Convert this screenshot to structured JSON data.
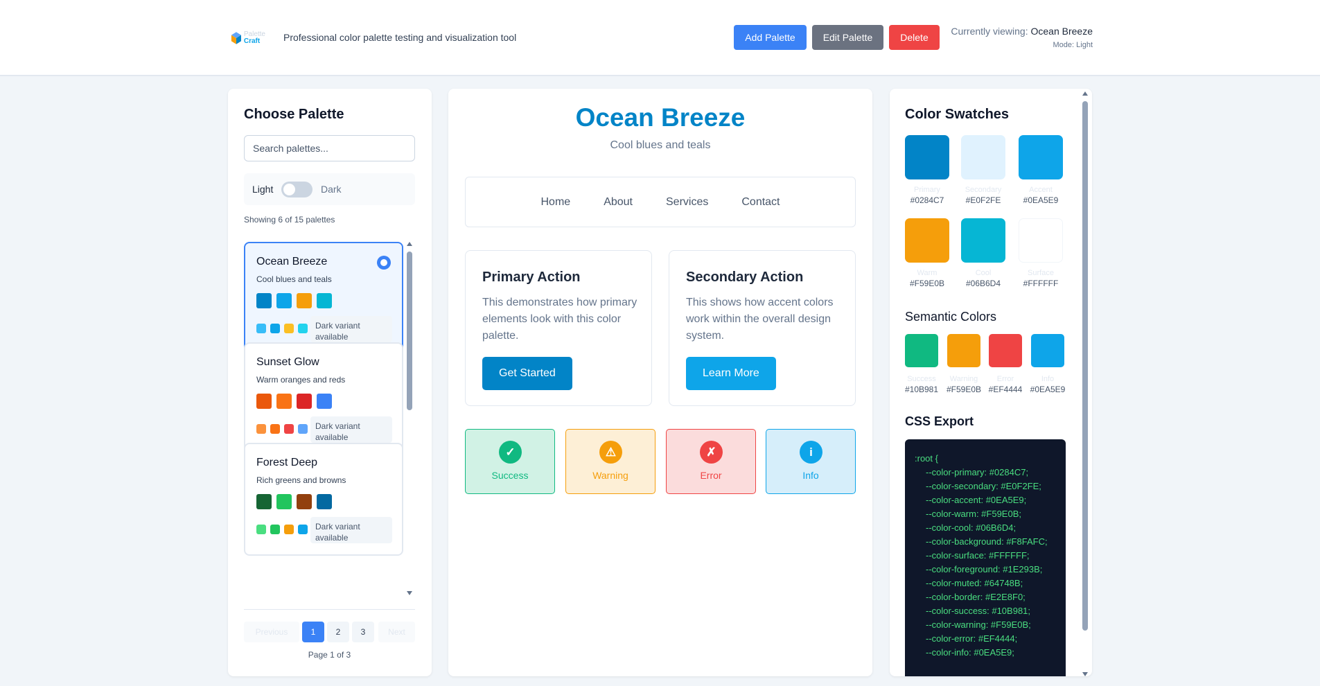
{
  "header": {
    "logo_top": "Palette",
    "logo_bottom": "Craft",
    "tagline": "Professional color palette testing and visualization tool",
    "add_label": "Add Palette",
    "edit_label": "Edit Palette",
    "delete_label": "Delete",
    "viewing_label": "Currently viewing:",
    "viewing_name": "Ocean Breeze",
    "mode_text": "Mode: Light"
  },
  "sidebar": {
    "title": "Choose Palette",
    "search_placeholder": "Search palettes...",
    "toggle_light": "Light",
    "toggle_dark": "Dark",
    "showing": "Showing 6 of 15 palettes",
    "palettes": [
      {
        "name": "Ocean Breeze",
        "description": "Cool blues and teals",
        "colors": [
          "#0284C7",
          "#0EA5E9",
          "#F59E0B",
          "#06B6D4"
        ],
        "dark_colors": [
          "#38BDF8",
          "#0EA5E9",
          "#FBBF24",
          "#22D3EE"
        ],
        "dark_label": "Dark variant available",
        "selected": true
      },
      {
        "name": "Sunset Glow",
        "description": "Warm oranges and reds",
        "colors": [
          "#EA580C",
          "#F97316",
          "#DC2626",
          "#3B82F6"
        ],
        "dark_colors": [
          "#FB923C",
          "#F97316",
          "#EF4444",
          "#60A5FA"
        ],
        "dark_label": "Dark variant available",
        "selected": false
      },
      {
        "name": "Forest Deep",
        "description": "Rich greens and browns",
        "colors": [
          "#166534",
          "#22C55E",
          "#92400E",
          "#0369A1"
        ],
        "dark_colors": [
          "#4ADE80",
          "#22C55E",
          "#F59E0B",
          "#0EA5E9"
        ],
        "dark_label": "Dark variant available",
        "selected": false
      }
    ],
    "pagination": {
      "prev": "Previous",
      "pages": [
        "1",
        "2",
        "3"
      ],
      "next": "Next",
      "info": "Page 1 of 3"
    }
  },
  "preview": {
    "title": "Ocean Breeze",
    "subtitle": "Cool blues and teals",
    "nav": [
      "Home",
      "About",
      "Services",
      "Contact"
    ],
    "cards": [
      {
        "title": "Primary Action",
        "text": "This demonstrates how primary elements look with this color palette.",
        "button": "Get Started"
      },
      {
        "title": "Secondary Action",
        "text": "This shows how accent colors work within the overall design system.",
        "button": "Learn More"
      }
    ],
    "statuses": [
      {
        "label": "Success",
        "icon": "✓"
      },
      {
        "label": "Warning",
        "icon": "⚠"
      },
      {
        "label": "Error",
        "icon": "✗"
      },
      {
        "label": "Info",
        "icon": "i"
      }
    ]
  },
  "swatches": {
    "title": "Color Swatches",
    "items": [
      {
        "name": "Primary",
        "hex": "#0284C7"
      },
      {
        "name": "Secondary",
        "hex": "#E0F2FE"
      },
      {
        "name": "Accent",
        "hex": "#0EA5E9"
      },
      {
        "name": "Warm",
        "hex": "#F59E0B"
      },
      {
        "name": "Cool",
        "hex": "#06B6D4"
      },
      {
        "name": "Surface",
        "hex": "#FFFFFF"
      }
    ],
    "semantic_title": "Semantic Colors",
    "semantic": [
      {
        "name": "Success",
        "hex": "#10B981"
      },
      {
        "name": "Warning",
        "hex": "#F59E0B"
      },
      {
        "name": "Error",
        "hex": "#EF4444"
      },
      {
        "name": "Info",
        "hex": "#0EA5E9"
      }
    ],
    "css_title": "CSS Export",
    "css_open": ":root {",
    "css_lines": [
      "--color-primary: #0284C7;",
      "--color-secondary: #E0F2FE;",
      "--color-accent: #0EA5E9;",
      "--color-warm: #F59E0B;",
      "--color-cool: #06B6D4;",
      "--color-background: #F8FAFC;",
      "--color-surface: #FFFFFF;",
      "--color-foreground: #1E293B;",
      "--color-muted: #64748B;",
      "--color-border: #E2E8F0;",
      "--color-success: #10B981;",
      "--color-warning: #F59E0B;",
      "--color-error: #EF4444;",
      "--color-info: #0EA5E9;"
    ]
  }
}
